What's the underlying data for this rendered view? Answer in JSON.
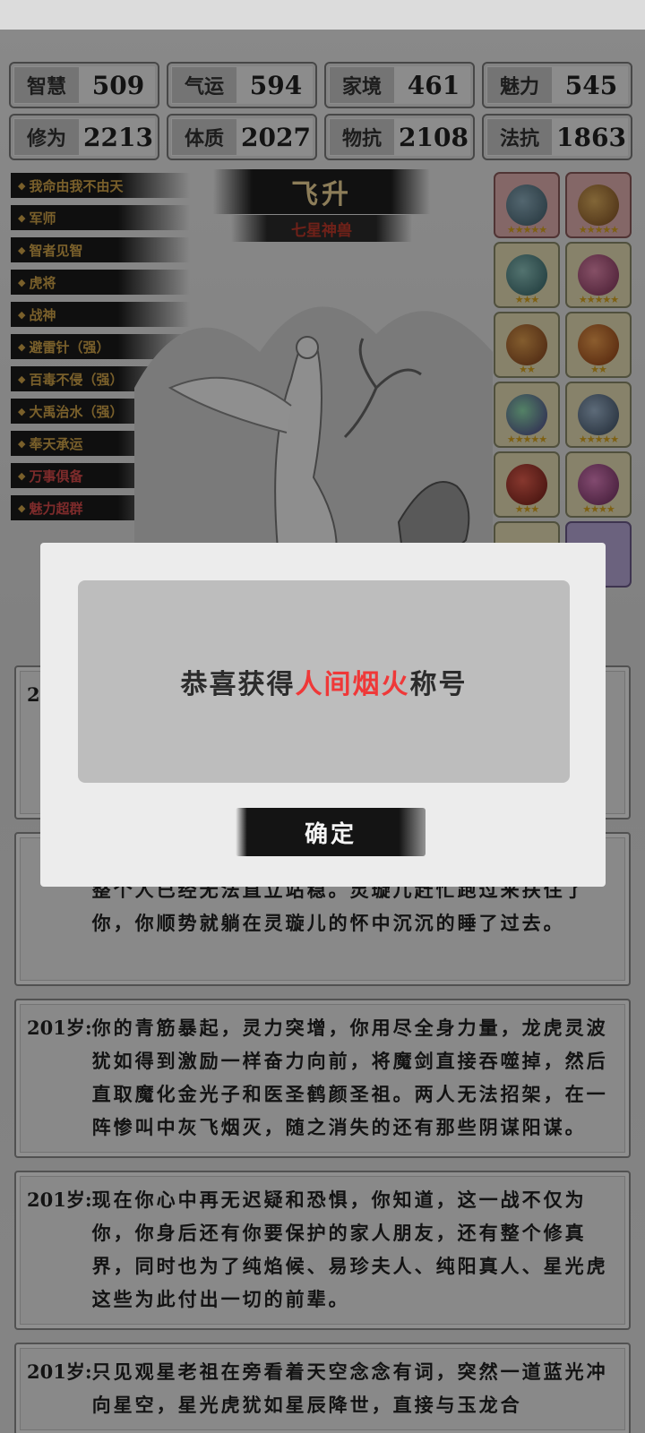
{
  "stats": {
    "row1": [
      {
        "label": "智慧",
        "value": "509"
      },
      {
        "label": "气运",
        "value": "594"
      },
      {
        "label": "家境",
        "value": "461"
      },
      {
        "label": "魅力",
        "value": "545"
      }
    ],
    "row2": [
      {
        "label": "修为",
        "value": "2213"
      },
      {
        "label": "体质",
        "value": "2027"
      },
      {
        "label": "物抗",
        "value": "2108"
      },
      {
        "label": "法抗",
        "value": "1863"
      }
    ]
  },
  "titles": [
    "我命由我不由天",
    "军师",
    "智者见智",
    "虎将",
    "战神",
    "避雷针（强）",
    "百毒不侵（强）",
    "大禹治水（强）",
    "奉天承运",
    "万事俱备",
    "魅力超群"
  ],
  "rank": {
    "name": "飞升",
    "sub": "七星神兽"
  },
  "equipment_icons": [
    "battle-axe-icon",
    "sword-icon",
    "dagger-icon",
    "pouch-icon",
    "incense-burner-icon",
    "ring-icon",
    "gem-icon",
    "blade-icon",
    "ring-red-icon",
    "teapot-icon"
  ],
  "events": [
    {
      "age": "201岁:",
      "text": "你的青筋暴起，灵力突增，你用尽全身力量，龙虎灵波犹如得到激励一样奋力向前，将魔剑直接吞噬掉，然后直取魔化金光子和医圣鹤颜圣祖。两人无法招架，在一阵惨叫中灰飞烟灭，随之消失的还有那些阴谋阳谋。"
    },
    {
      "age": "201岁:",
      "text": "现在你心中再无迟疑和恐惧，你知道，这一战不仅为你，你身后还有你要保护的家人朋友，还有整个修真界，同时也为了纯焰候、易珍夫人、纯阳真人、星光虎这些为此付出一切的前辈。"
    },
    {
      "age": "201岁:",
      "text": "只见观星老祖在旁看着天空念念有词，突然一道蓝光冲向星空，星光虎犹如星辰降世，直接与玉龙合"
    }
  ],
  "partial_event": {
    "text": "整个人已经无法直立站稳。灵璇儿赶忙跑过来扶住了你，你顺势就躺在灵璇儿的怀中沉沉的睡了过去。"
  },
  "dialog": {
    "prefix": "恭喜获得",
    "highlight": "人间烟火",
    "suffix": "称号",
    "ok_label": "确定",
    "highlight_color": "#ef3838"
  }
}
